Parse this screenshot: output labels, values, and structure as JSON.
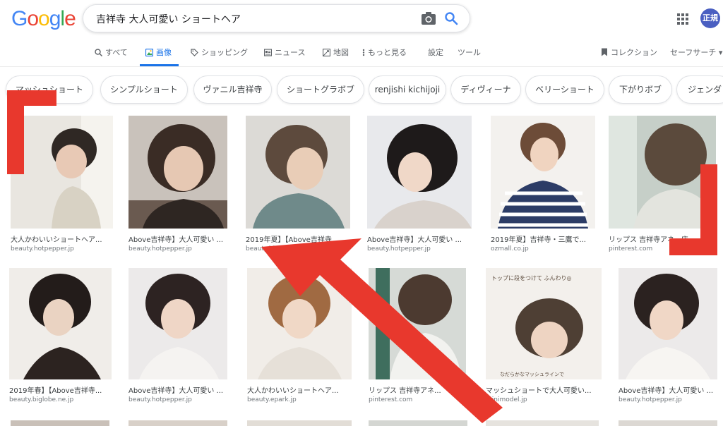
{
  "header": {
    "logo_letters": [
      "G",
      "o",
      "o",
      "g",
      "l",
      "e"
    ],
    "search_query": "吉祥寺 大人可愛い ショートヘア",
    "avatar_label": "正規"
  },
  "colors": {
    "accent": "#1a73e8",
    "annotation_red": "#e8382d"
  },
  "tabs": [
    {
      "label": "すべて",
      "icon": "search-icon",
      "active": false
    },
    {
      "label": "画像",
      "icon": "image-icon",
      "active": true
    },
    {
      "label": "ショッピング",
      "icon": "tag-icon",
      "active": false
    },
    {
      "label": "ニュース",
      "icon": "news-icon",
      "active": false
    },
    {
      "label": "地図",
      "icon": "map-icon",
      "active": false
    },
    {
      "label": "もっと見る",
      "icon": "more-icon",
      "active": false
    },
    {
      "label": "設定",
      "icon": "",
      "active": false
    },
    {
      "label": "ツール",
      "icon": "",
      "active": false
    }
  ],
  "right_tools": {
    "collections": "コレクション",
    "safe_search": "セーフサーチ ▾"
  },
  "chips": [
    "マッシュショート",
    "シンプルショート",
    "ヴァニル吉祥寺",
    "ショートグラボブ",
    "renjishi kichijoji",
    "ディヴィーナ",
    "ベリーショート",
    "下がりボブ",
    "ジェンダ"
  ],
  "results_row1": [
    {
      "title": "大人かわいいショートヘア...",
      "domain": "beauty.hotpepper.jp"
    },
    {
      "title": "Above吉祥寺】大人可愛い ...",
      "domain": "beauty.hotpepper.jp"
    },
    {
      "title": "2019年夏】【Above吉祥寺...",
      "domain": "beauty.biglobe.ne.jp"
    },
    {
      "title": "Above吉祥寺】大人可愛い ...",
      "domain": "beauty.hotpepper.jp"
    },
    {
      "title": "2019年夏】吉祥寺・三鷹で...",
      "domain": "ozmall.co.jp"
    },
    {
      "title": "リップス 吉祥寺アネ...店",
      "domain": "pinterest.com"
    }
  ],
  "results_row2": [
    {
      "title": "2019年春】【Above吉祥寺...",
      "domain": "beauty.biglobe.ne.jp"
    },
    {
      "title": "Above吉祥寺】大人可愛い ...",
      "domain": "beauty.hotpepper.jp"
    },
    {
      "title": "大人かわいいショートヘア...",
      "domain": "beauty.epark.jp"
    },
    {
      "title": "リップス 吉祥寺アネ...",
      "domain": "pinterest.com"
    },
    {
      "title": "マッシュショートで大人可愛い...",
      "domain": "minimodel.jp"
    },
    {
      "title": "Above吉祥寺】大人可愛い ...",
      "domain": "beauty.hotpepper.jp"
    }
  ],
  "image_captions": {
    "mash_top": "トップに段をつけて ふんわり◎",
    "mash_bottom": "なだらかなマッシュラインで"
  }
}
